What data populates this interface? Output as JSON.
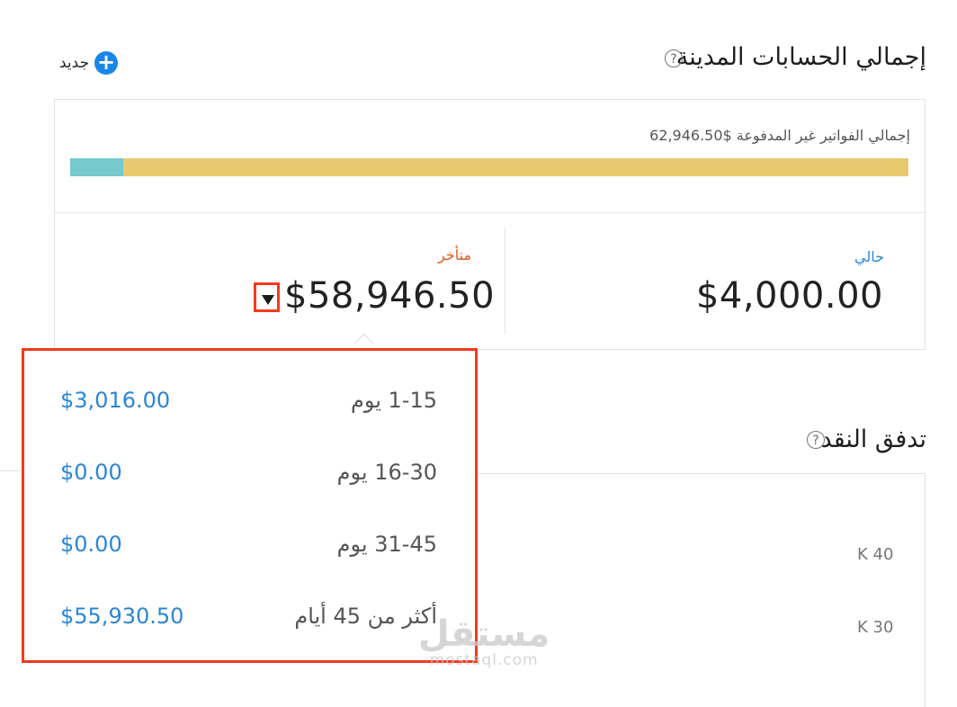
{
  "receivables": {
    "title": "إجمالي الحسابات المدينة",
    "help": "?",
    "new_button_label": "جديد",
    "unpaid_label": "إجمالي الفواتير غير المدفوعة $62,946.50",
    "current_label": "حالي",
    "current_value": "$4,000.00",
    "overdue_label": "متأخر",
    "overdue_value": "$58,946.50",
    "bar_current_fraction": 0.0635,
    "bar_colors": {
      "current": "#76c9cc",
      "overdue": "#e9c96e"
    }
  },
  "overdue_breakdown": {
    "rows": [
      {
        "range": "1-15 يوم",
        "amount": "$3,016.00"
      },
      {
        "range": "16-30 يوم",
        "amount": "$0.00"
      },
      {
        "range": "31-45 يوم",
        "amount": "$0.00"
      },
      {
        "range": "أكثر من 45 أيام",
        "amount": "$55,930.50"
      }
    ]
  },
  "cash_flow": {
    "title": "تدفق النقد",
    "help": "?",
    "y_ticks": [
      "K 40",
      "K 30"
    ]
  },
  "watermark": {
    "brand": "مستقل",
    "domain": "mostaql.com"
  },
  "colors": {
    "accent": "#1a87e6",
    "link": "#2b86d6",
    "overdue": "#e2571e",
    "highlight": "#f03b1f"
  }
}
